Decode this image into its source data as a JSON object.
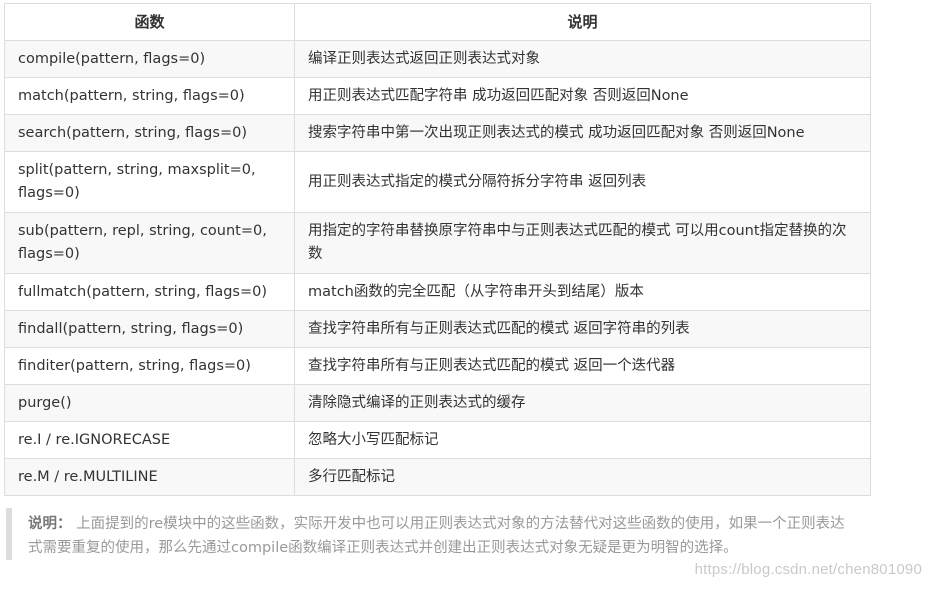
{
  "table": {
    "headers": [
      "函数",
      "说明"
    ],
    "rows": [
      [
        "compile(pattern, flags=0)",
        "编译正则表达式返回正则表达式对象"
      ],
      [
        "match(pattern, string, flags=0)",
        "用正则表达式匹配字符串 成功返回匹配对象 否则返回None"
      ],
      [
        "search(pattern, string, flags=0)",
        "搜索字符串中第一次出现正则表达式的模式 成功返回匹配对象 否则返回None"
      ],
      [
        "split(pattern, string, maxsplit=0, flags=0)",
        "用正则表达式指定的模式分隔符拆分字符串 返回列表"
      ],
      [
        "sub(pattern, repl, string, count=0, flags=0)",
        "用指定的字符串替换原字符串中与正则表达式匹配的模式 可以用count指定替换的次数"
      ],
      [
        "fullmatch(pattern, string, flags=0)",
        "match函数的完全匹配（从字符串开头到结尾）版本"
      ],
      [
        "findall(pattern, string, flags=0)",
        "查找字符串所有与正则表达式匹配的模式 返回字符串的列表"
      ],
      [
        "finditer(pattern, string, flags=0)",
        "查找字符串所有与正则表达式匹配的模式 返回一个迭代器"
      ],
      [
        "purge()",
        "清除隐式编译的正则表达式的缓存"
      ],
      [
        "re.I / re.IGNORECASE",
        "忽略大小写匹配标记"
      ],
      [
        "re.M / re.MULTILINE",
        "多行匹配标记"
      ]
    ]
  },
  "note": {
    "label": "说明：",
    "text": " 上面提到的re模块中的这些函数，实际开发中也可以用正则表达式对象的方法替代对这些函数的使用，如果一个正则表达式需要重复的使用，那么先通过compile函数编译正则表达式并创建出正则表达式对象无疑是更为明智的选择。"
  },
  "watermark": "https://blog.csdn.net/chen801090"
}
